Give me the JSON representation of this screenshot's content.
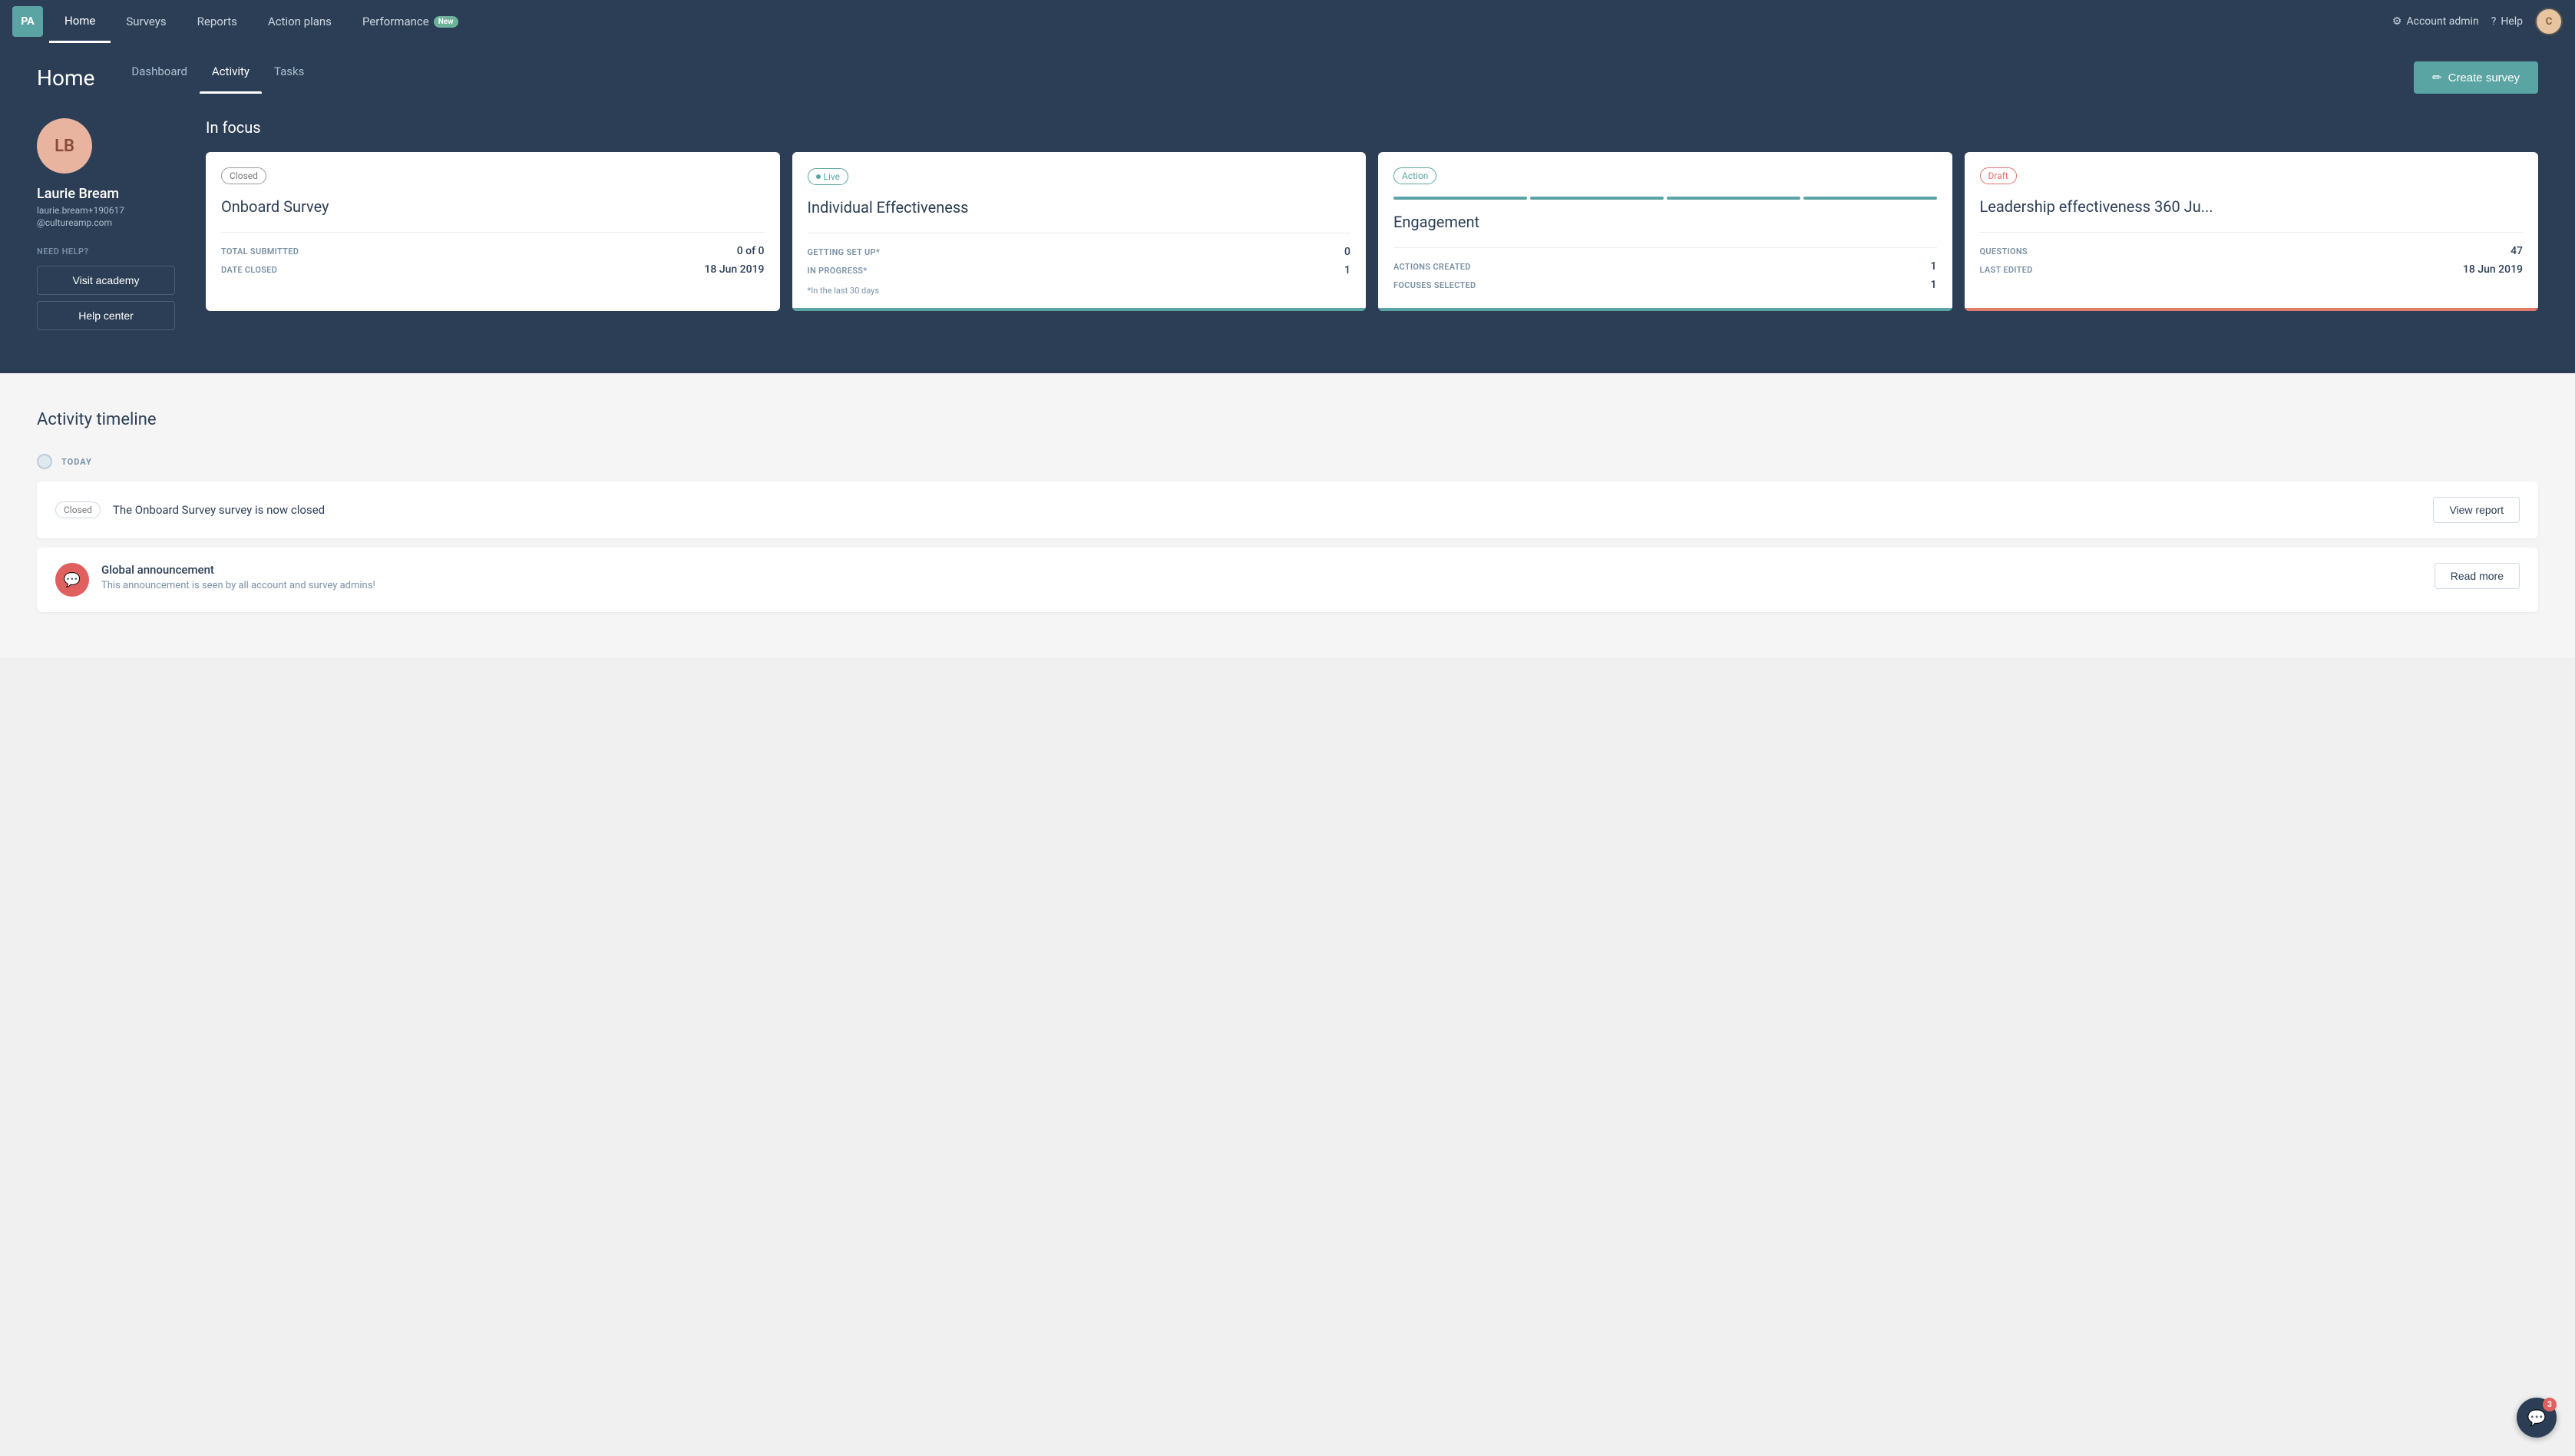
{
  "nav": {
    "logo": "PA",
    "items": [
      {
        "label": "Home",
        "active": true
      },
      {
        "label": "Surveys",
        "active": false
      },
      {
        "label": "Reports",
        "active": false
      },
      {
        "label": "Action plans",
        "active": false
      },
      {
        "label": "Performance",
        "active": false,
        "badge": "New"
      }
    ],
    "right": {
      "account_admin": "Account admin",
      "help": "Help",
      "user_initials": "C"
    }
  },
  "header": {
    "title": "Home",
    "tabs": [
      {
        "label": "Dashboard",
        "active": false
      },
      {
        "label": "Activity",
        "active": true
      },
      {
        "label": "Tasks",
        "active": false
      }
    ],
    "create_survey_btn": "Create survey"
  },
  "profile": {
    "initials": "LB",
    "name": "Laurie Bream",
    "email": "laurie.bream+190617",
    "domain": "@cultureamp.com",
    "need_help": "NEED HELP?",
    "visit_academy": "Visit academy",
    "help_center": "Help center"
  },
  "in_focus": {
    "title": "In focus",
    "cards": [
      {
        "status": "Closed",
        "status_type": "closed",
        "title": "Onboard Survey",
        "stats": [
          {
            "label": "TOTAL SUBMITTED",
            "value": "0 of 0"
          },
          {
            "label": "DATE CLOSED",
            "value": "18 Jun 2019"
          }
        ],
        "bar_color": "none"
      },
      {
        "status": "Live",
        "status_type": "live",
        "title": "Individual Effectiveness",
        "stats": [
          {
            "label": "GETTING SET UP*",
            "value": "0"
          },
          {
            "label": "IN PROGRESS*",
            "value": "1"
          }
        ],
        "footnote": "*In the last 30 days",
        "bar_color": "green"
      },
      {
        "status": "Action",
        "status_type": "action",
        "title": "Engagement",
        "stats": [
          {
            "label": "ACTIONS CREATED",
            "value": "1"
          },
          {
            "label": "FOCUSES SELECTED",
            "value": "1"
          }
        ],
        "bar_color": "green",
        "progress_bars": [
          "#5ba4a4",
          "#5ba4a4",
          "#5ba4a4",
          "#5ba4a4"
        ]
      },
      {
        "status": "Draft",
        "status_type": "draft",
        "title": "Leadership effectiveness 360 Ju...",
        "stats": [
          {
            "label": "QUESTIONS",
            "value": "47"
          },
          {
            "label": "LAST EDITED",
            "value": "18 Jun 2019"
          }
        ],
        "bar_color": "salmon"
      }
    ]
  },
  "activity_timeline": {
    "title": "Activity timeline",
    "day_label": "TODAY",
    "items": [
      {
        "type": "survey_closed",
        "badge": "Closed",
        "text": "The Onboard Survey survey is now closed",
        "action_label": "View report"
      },
      {
        "type": "announcement",
        "icon": "💬",
        "title": "Global announcement",
        "subtitle": "This announcement is seen by all account and survey admins!",
        "action_label": "Read more"
      }
    ]
  },
  "chat": {
    "badge": "3"
  }
}
